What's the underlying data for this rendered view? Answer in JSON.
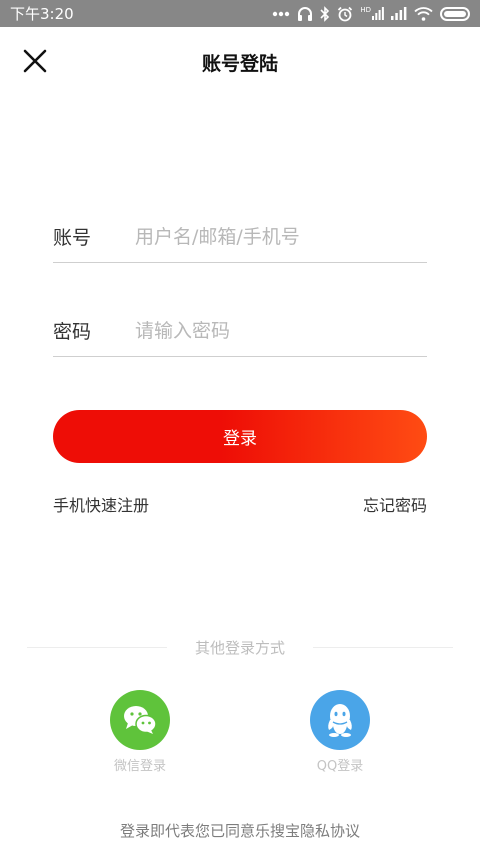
{
  "status_bar": {
    "time": "下午3:20",
    "icons": [
      "more-dots-icon",
      "headphones-icon",
      "bluetooth-icon",
      "alarm-icon",
      "hd-signal-icon",
      "signal-icon",
      "wifi-icon",
      "battery-icon"
    ],
    "hd_label": "HD"
  },
  "header": {
    "title": "账号登陆",
    "close_icon": "close-icon"
  },
  "form": {
    "account_label": "账号",
    "account_placeholder": "用户名/邮箱/手机号",
    "password_label": "密码",
    "password_placeholder": "请输入密码",
    "login_label": "登录"
  },
  "links": {
    "register": "手机快速注册",
    "forgot": "忘记密码"
  },
  "other_login": {
    "title": "其他登录方式",
    "wechat_label": "微信登录",
    "qq_label": "QQ登录"
  },
  "agreement": "登录即代表您已同意乐搜宝隐私协议",
  "colors": {
    "status_bar": "#878787",
    "login_button_start": "#ee0d06",
    "login_button_end": "#ff4c13",
    "wechat": "#5fc33b",
    "qq": "#4aa5e8"
  }
}
